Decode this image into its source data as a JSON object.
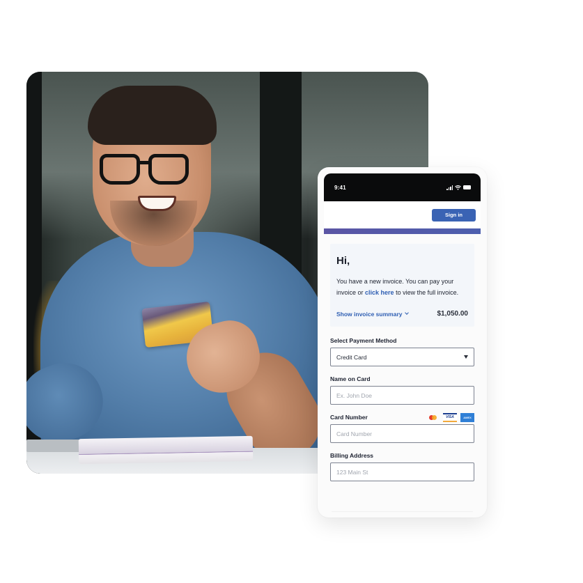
{
  "photo": {
    "description": "Smiling man in denim shirt and glasses holding a credit card at a desk"
  },
  "phone": {
    "status_bar": {
      "time": "9:41",
      "icons": [
        "cellular-signal-icon",
        "wifi-icon",
        "battery-icon"
      ]
    },
    "header": {
      "sign_in_label": "Sign in"
    },
    "colors": {
      "primary": "#3a63b4",
      "brand_bar_start": "#5b55a4",
      "brand_bar_end": "#4d5fae",
      "link": "#2f5fb3",
      "card_bg": "#f3f6fa"
    },
    "intro": {
      "greeting": "Hi,",
      "text_before_link": "You have a new invoice. You can pay your invoice or ",
      "link_text": "click here",
      "text_after_link": " to view the full invoice.",
      "summary_toggle": "Show invoice summary",
      "amount": "$1,050.00"
    },
    "form": {
      "payment_method": {
        "label": "Select Payment Method",
        "value": "Credit Card"
      },
      "name_on_card": {
        "label": "Name on Card",
        "placeholder": "Ex. John Doe"
      },
      "card_number": {
        "label": "Card Number",
        "placeholder": "Card Number",
        "card_brands": [
          "Mastercard",
          "VISA",
          "AMEX"
        ]
      },
      "billing_address": {
        "label": "Billing Address",
        "placeholder": "123 Main St"
      }
    }
  }
}
